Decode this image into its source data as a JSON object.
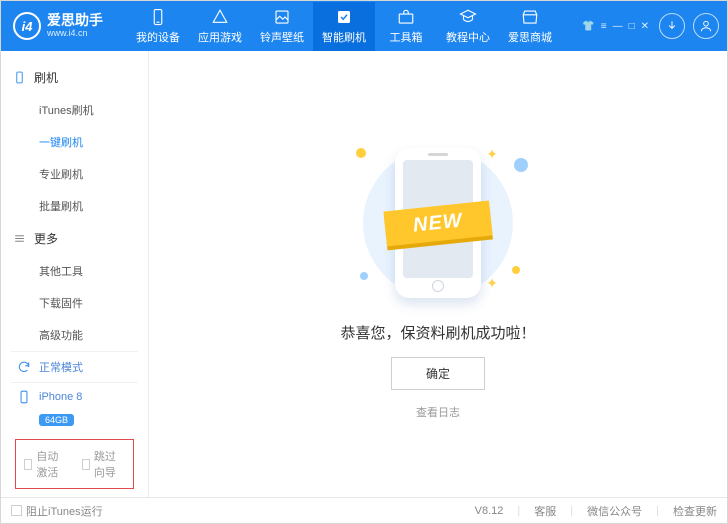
{
  "header": {
    "logo_badge": "i4",
    "brand_cn": "爱思助手",
    "brand_en": "www.i4.cn",
    "nav": [
      {
        "label": "我的设备"
      },
      {
        "label": "应用游戏"
      },
      {
        "label": "铃声壁纸"
      },
      {
        "label": "智能刷机"
      },
      {
        "label": "工具箱"
      },
      {
        "label": "教程中心"
      },
      {
        "label": "爱思商城"
      }
    ]
  },
  "sidebar": {
    "group1_title": "刷机",
    "group1_items": [
      "iTunes刷机",
      "一键刷机",
      "专业刷机",
      "批量刷机"
    ],
    "group2_title": "更多",
    "group2_items": [
      "其他工具",
      "下载固件",
      "高级功能"
    ],
    "mode_label": "正常模式",
    "device_name": "iPhone 8",
    "device_capacity": "64GB",
    "chk_auto_activate": "自动激活",
    "chk_skip_guide": "跳过向导"
  },
  "main": {
    "banner": "NEW",
    "success_msg": "恭喜您，保资料刷机成功啦！",
    "ok_button": "确定",
    "view_log": "查看日志"
  },
  "status": {
    "block_itunes": "阻止iTunes运行",
    "version": "V8.12",
    "support": "客服",
    "wechat": "微信公众号",
    "update": "检查更新"
  }
}
